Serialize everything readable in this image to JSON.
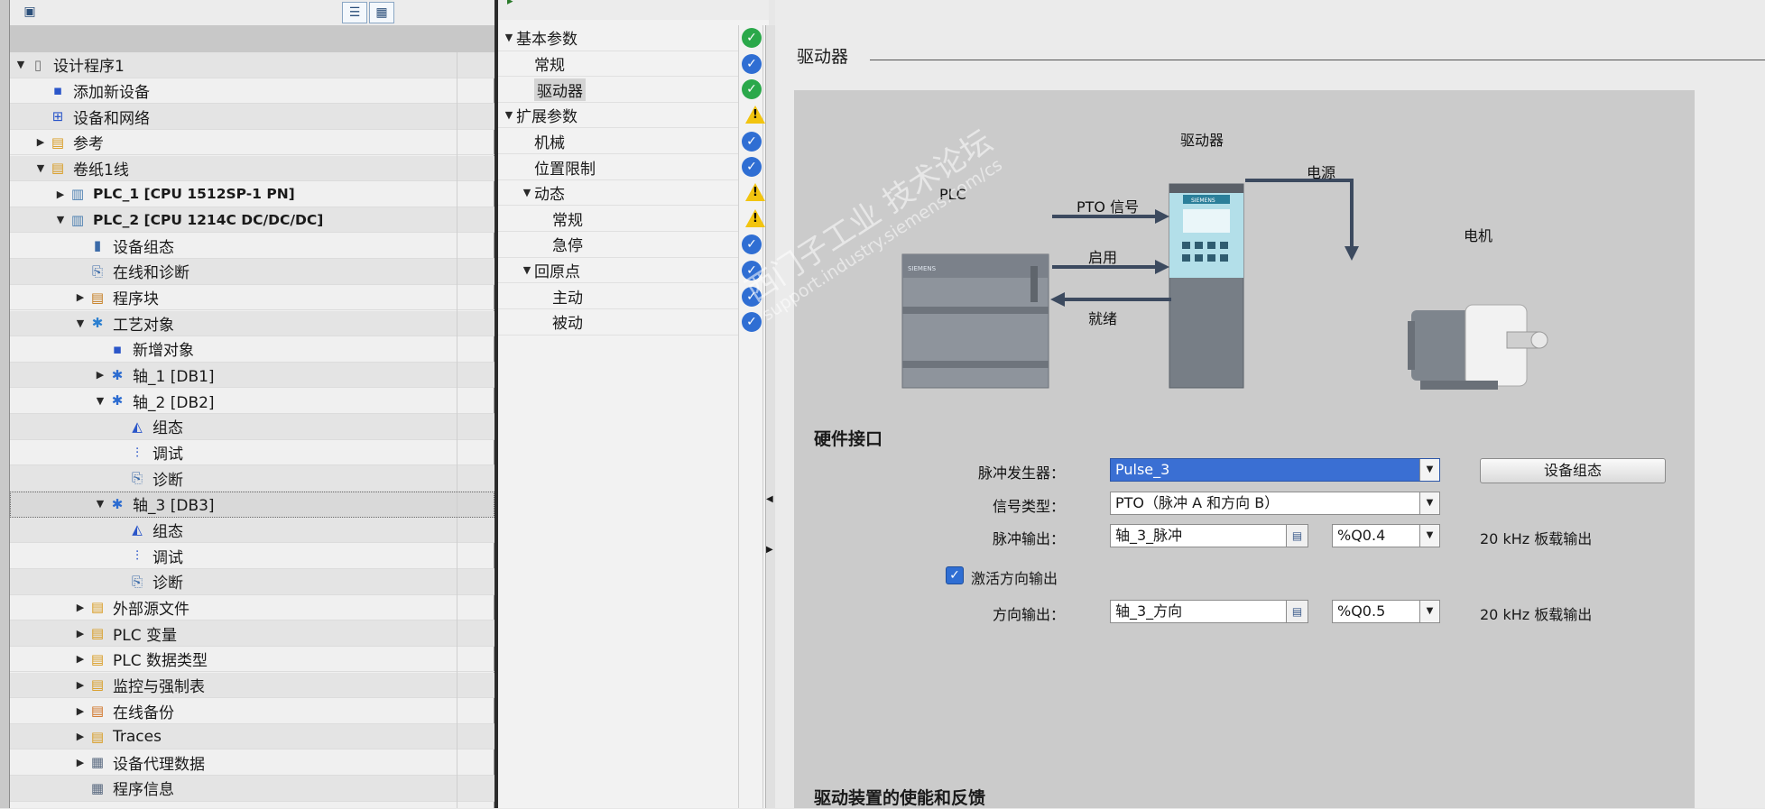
{
  "left_tree": [
    {
      "label": "设计程序1",
      "depth": 0,
      "tri": "▼",
      "icon": "document-icon"
    },
    {
      "label": "添加新设备",
      "depth": 1,
      "tri": "",
      "icon": "add-device-icon"
    },
    {
      "label": "设备和网络",
      "depth": 1,
      "tri": "",
      "icon": "network-icon"
    },
    {
      "label": "参考",
      "depth": 1,
      "tri": "▶",
      "icon": "folder-icon"
    },
    {
      "label": "卷纸1线",
      "depth": 1,
      "tri": "▼",
      "icon": "folder-icon"
    },
    {
      "label": "PLC_1 [CPU 1512SP-1 PN]",
      "depth": 2,
      "tri": "▶",
      "icon": "plc-icon",
      "bold": true
    },
    {
      "label": "PLC_2 [CPU 1214C DC/DC/DC]",
      "depth": 2,
      "tri": "▼",
      "icon": "plc-icon",
      "bold": true
    },
    {
      "label": "设备组态",
      "depth": 3,
      "tri": "",
      "icon": "device-config-icon"
    },
    {
      "label": "在线和诊断",
      "depth": 3,
      "tri": "",
      "icon": "diagnostics-icon"
    },
    {
      "label": "程序块",
      "depth": 3,
      "tri": "▶",
      "icon": "program-blocks-icon"
    },
    {
      "label": "工艺对象",
      "depth": 3,
      "tri": "▼",
      "icon": "tech-objects-icon"
    },
    {
      "label": "新增对象",
      "depth": 4,
      "tri": "",
      "icon": "add-object-icon"
    },
    {
      "label": "轴_1 [DB1]",
      "depth": 4,
      "tri": "▶",
      "icon": "axis-icon"
    },
    {
      "label": "轴_2 [DB2]",
      "depth": 4,
      "tri": "▼",
      "icon": "axis-icon"
    },
    {
      "label": "组态",
      "depth": 5,
      "tri": "",
      "icon": "config-icon"
    },
    {
      "label": "调试",
      "depth": 5,
      "tri": "",
      "icon": "commissioning-icon"
    },
    {
      "label": "诊断",
      "depth": 5,
      "tri": "",
      "icon": "diagnostics-icon"
    },
    {
      "label": "轴_3 [DB3]",
      "depth": 4,
      "tri": "▼",
      "icon": "axis-icon",
      "selected": true
    },
    {
      "label": "组态",
      "depth": 5,
      "tri": "",
      "icon": "config-icon"
    },
    {
      "label": "调试",
      "depth": 5,
      "tri": "",
      "icon": "commissioning-icon"
    },
    {
      "label": "诊断",
      "depth": 5,
      "tri": "",
      "icon": "diagnostics-icon"
    },
    {
      "label": "外部源文件",
      "depth": 3,
      "tri": "▶",
      "icon": "folder-icon"
    },
    {
      "label": "PLC 变量",
      "depth": 3,
      "tri": "▶",
      "icon": "tags-icon"
    },
    {
      "label": "PLC 数据类型",
      "depth": 3,
      "tri": "▶",
      "icon": "datatype-icon"
    },
    {
      "label": "监控与强制表",
      "depth": 3,
      "tri": "▶",
      "icon": "watch-table-icon"
    },
    {
      "label": "在线备份",
      "depth": 3,
      "tri": "▶",
      "icon": "backup-icon"
    },
    {
      "label": "Traces",
      "depth": 3,
      "tri": "▶",
      "icon": "trace-icon"
    },
    {
      "label": "设备代理数据",
      "depth": 3,
      "tri": "▶",
      "icon": "proxy-data-icon"
    },
    {
      "label": "程序信息",
      "depth": 3,
      "tri": "",
      "icon": "program-info-icon"
    }
  ],
  "nav_tree": [
    {
      "label": "基本参数",
      "depth": 0,
      "tri": "▼",
      "status": "ok"
    },
    {
      "label": "常规",
      "depth": 1,
      "tri": "",
      "status": "blue"
    },
    {
      "label": "驱动器",
      "depth": 1,
      "tri": "",
      "status": "ok",
      "selected": true
    },
    {
      "label": "扩展参数",
      "depth": 0,
      "tri": "▼",
      "status": "warn"
    },
    {
      "label": "机械",
      "depth": 1,
      "tri": "",
      "status": "blue"
    },
    {
      "label": "位置限制",
      "depth": 1,
      "tri": "",
      "status": "blue"
    },
    {
      "label": "动态",
      "depth": 1,
      "tri": "▼",
      "status": "warn"
    },
    {
      "label": "常规",
      "depth": 2,
      "tri": "",
      "status": "warn"
    },
    {
      "label": "急停",
      "depth": 2,
      "tri": "",
      "status": "blue"
    },
    {
      "label": "回原点",
      "depth": 1,
      "tri": "▼",
      "status": "blue"
    },
    {
      "label": "主动",
      "depth": 2,
      "tri": "",
      "status": "blue"
    },
    {
      "label": "被动",
      "depth": 2,
      "tri": "",
      "status": "blue"
    }
  ],
  "right": {
    "section_title": "驱动器",
    "diagram": {
      "plc": "PLC",
      "drive": "驱动器",
      "power": "电源",
      "motor": "电机",
      "pto": "PTO 信号",
      "enable": "启用",
      "ready": "就绪",
      "siemens": "SIEMENS"
    },
    "watermark": {
      "line1": "西门子工业 技术论坛",
      "line2": "support.industry.siemens.com/cs"
    },
    "hw_title": "硬件接口",
    "pulse_gen_label": "脉冲发生器：",
    "pulse_gen_value": "Pulse_3",
    "device_config_btn": "设备组态",
    "signal_type_label": "信号类型：",
    "signal_type_value": "PTO（脉冲 A 和方向 B）",
    "pulse_out_label": "脉冲输出：",
    "pulse_out_value": "轴_3_脉冲",
    "pulse_out_addr": "%Q0.4",
    "pulse_out_note": "20 kHz 板载输出",
    "dir_enable_label": "激活方向输出",
    "dir_enable_checked": true,
    "dir_out_label": "方向输出：",
    "dir_out_value": "轴_3_方向",
    "dir_out_addr": "%Q0.5",
    "dir_out_note": "20 kHz 板载输出",
    "enable_feedback_title": "驱动装置的使能和反馈"
  }
}
